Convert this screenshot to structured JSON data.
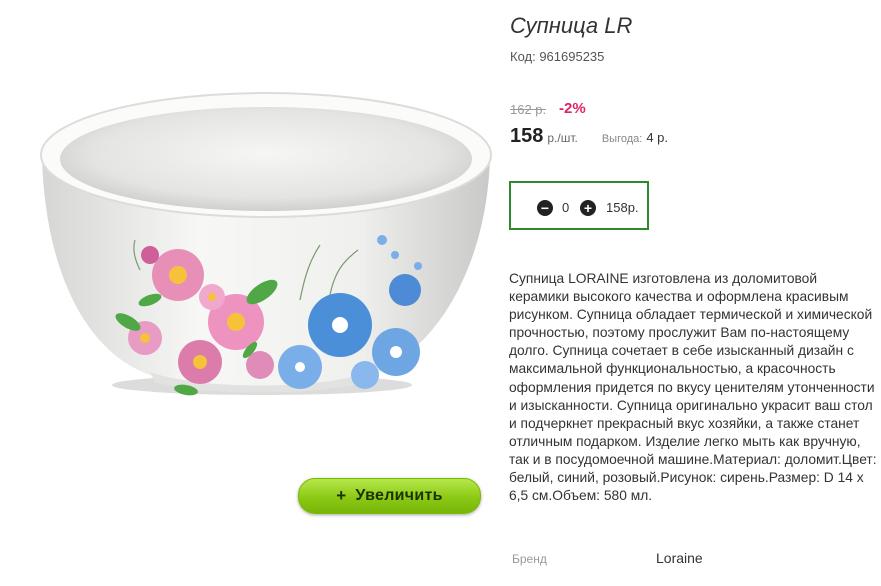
{
  "product": {
    "title": "Супница LR",
    "code": "Код: 961695235",
    "old_price": "162 р.",
    "discount": "-2%",
    "price": "158",
    "unit": "р./шт.",
    "benefit_label": "Выгода:",
    "benefit_value": "4 р.",
    "description": "Супница LORAINE изготовлена из доломитовой керамики высокого качества и оформлена красивым рисунком. Супница обладает термической и химической прочностью, поэтому прослужит Вам по-настоящему долго. Супница сочетает в себе изысканный дизайн с максимальной функциональностью, а красочность оформления придется по вкусу ценителям утонченности и изысканности. Супница оригинально украсит ваш стол и подчеркнет прекрасный вкус хозяйки, а также станет отличным подарком. Изделие легко мыть как вручную, так и в посудомоечной машине.Материал: доломит.Цвет: белый, синий, розовый.Рисунок: сирень.Размер: D 14 х 6,5 см.Объем: 580 мл.",
    "brand_label": "Бренд",
    "brand_value": "Loraine"
  },
  "quantity": {
    "minus": "−",
    "value": "0",
    "plus": "+",
    "total": "158р."
  },
  "zoom_button": {
    "plus": "+",
    "label": "Увеличить"
  },
  "image": {
    "alt": "white ceramic bowl with pink and blue flower pattern"
  },
  "colors": {
    "discount": "#e0245e",
    "qty_border": "#2c8a2c",
    "zoom_button": "#8cc914"
  }
}
